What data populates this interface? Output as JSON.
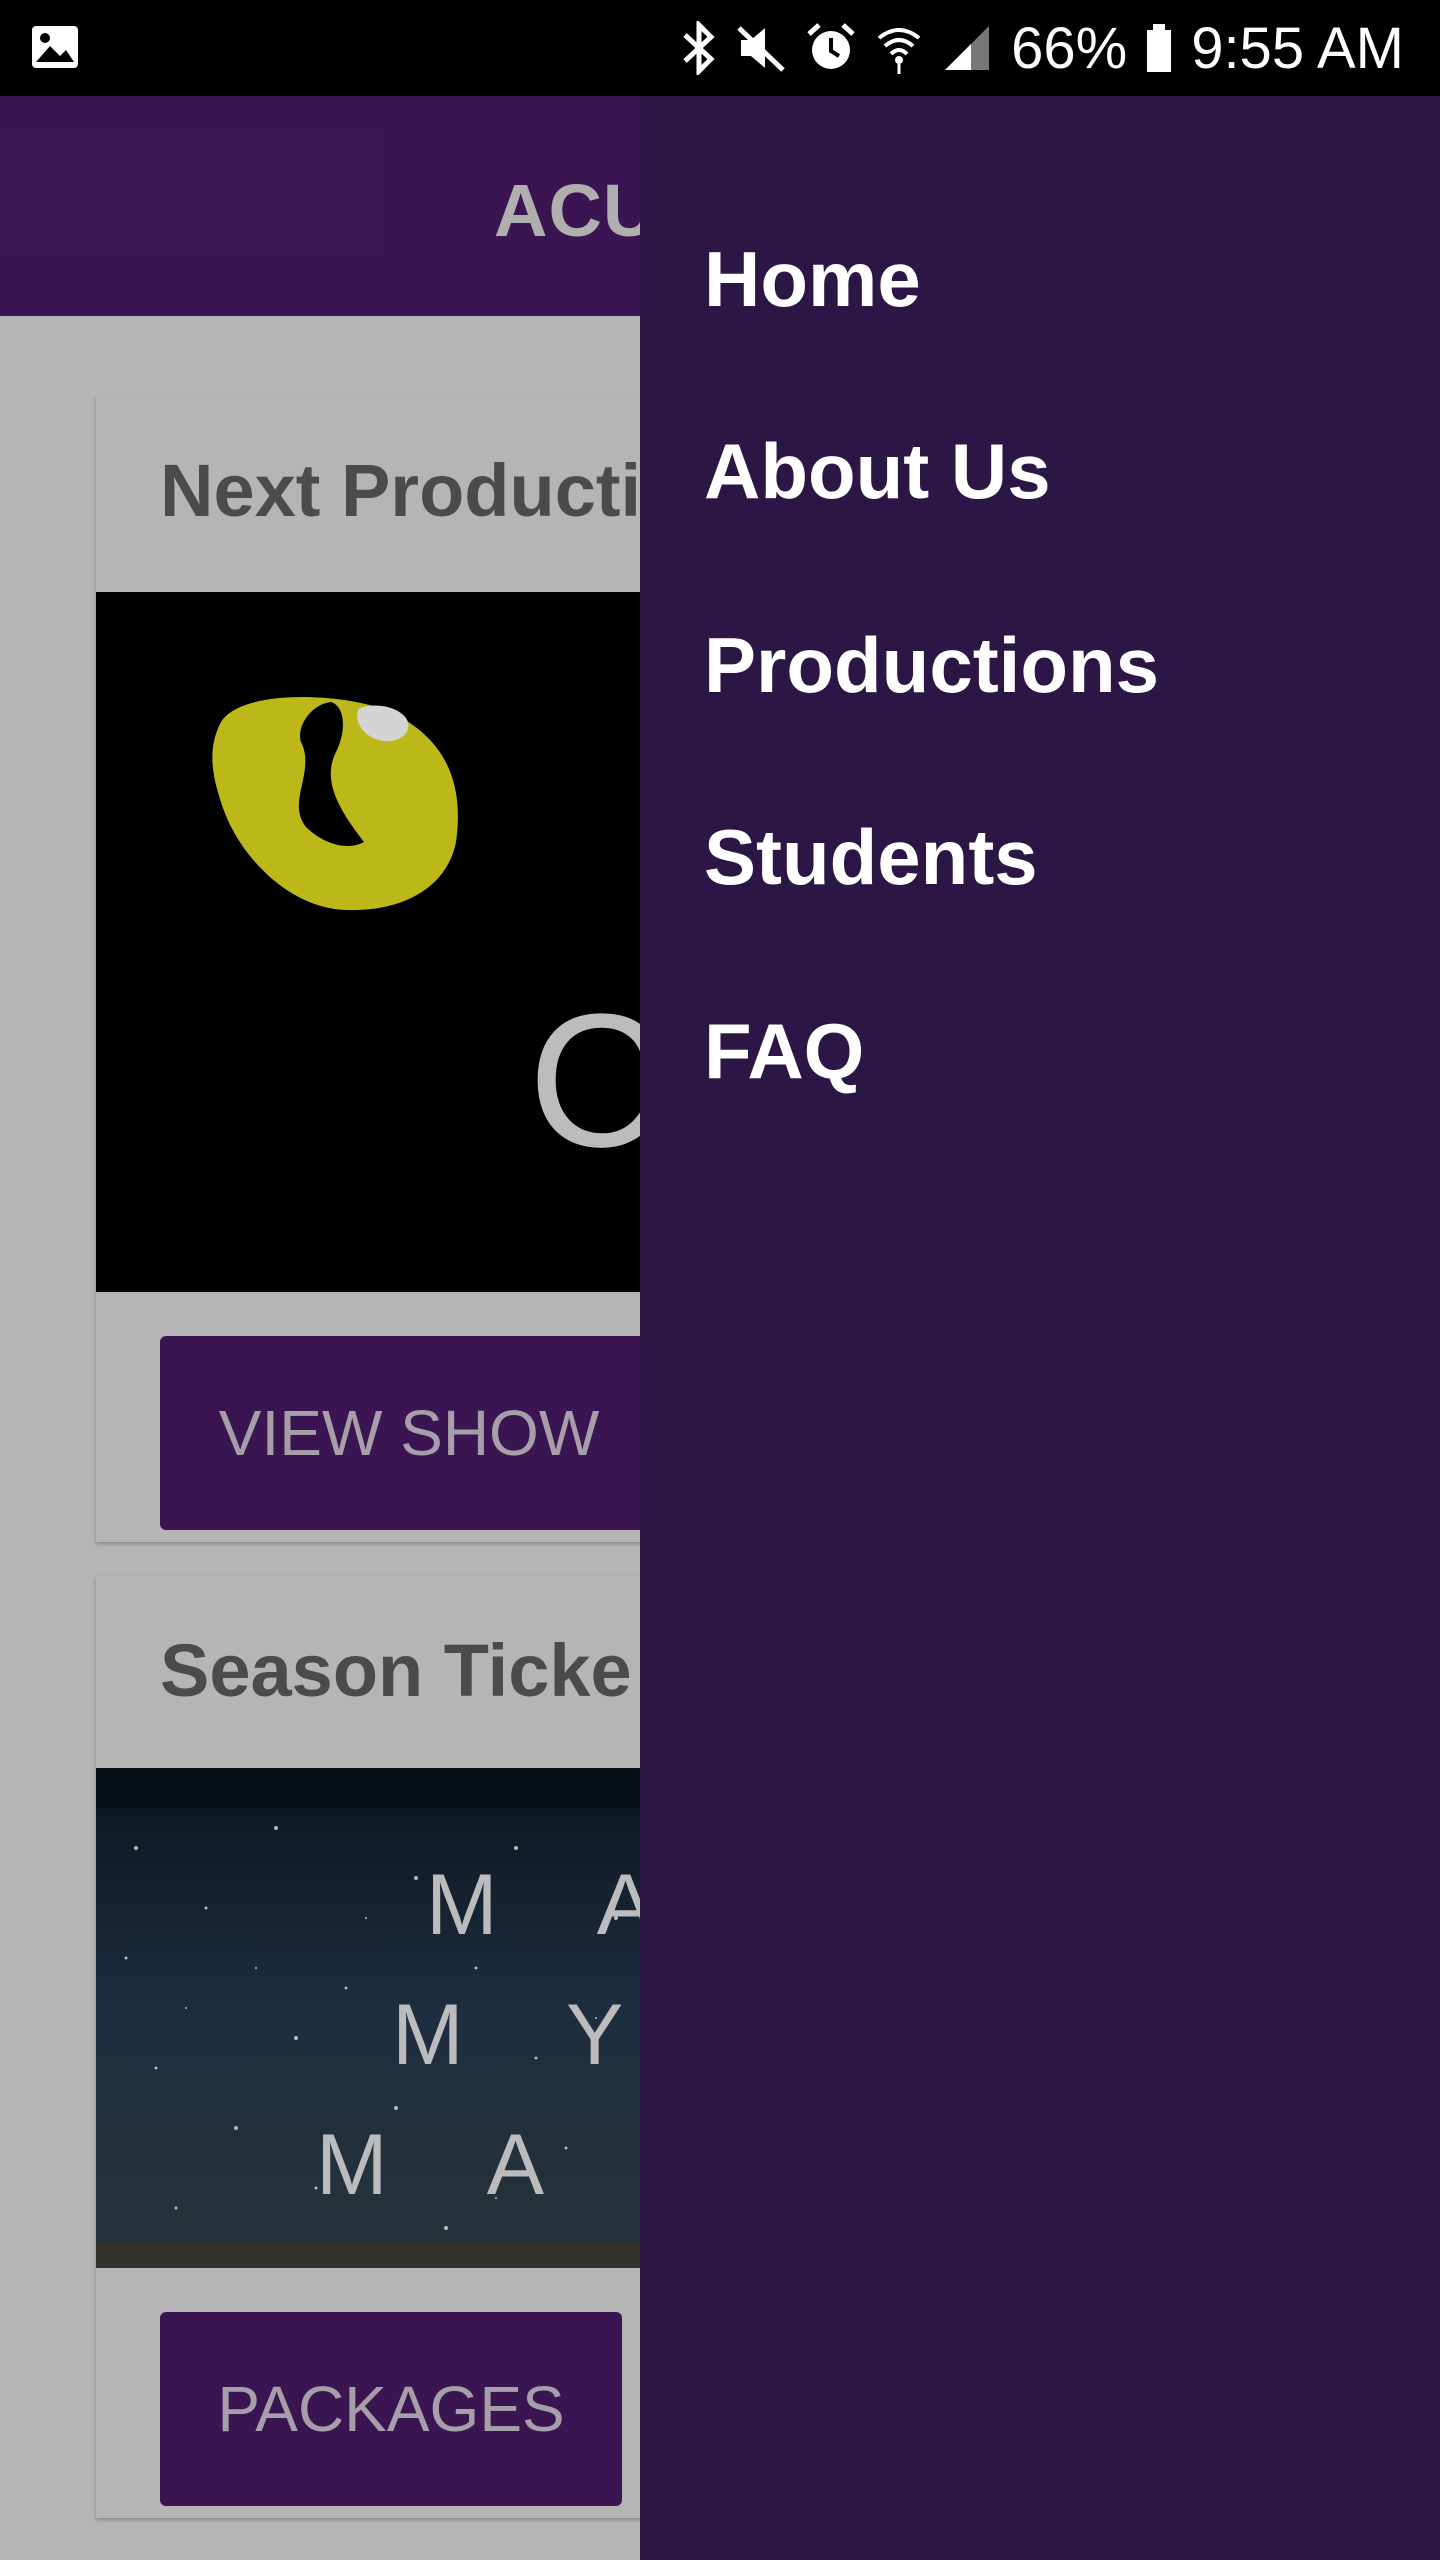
{
  "status_bar": {
    "battery": "66%",
    "time": "9:55 AM",
    "icons": [
      "image-icon",
      "bluetooth-icon",
      "mute-icon",
      "alarm-icon",
      "wifi-icon",
      "signal-icon",
      "battery-icon"
    ]
  },
  "app_bar": {
    "title": "ACU"
  },
  "cards": [
    {
      "title": "Next Producti",
      "image": "cats-poster",
      "poster_letter": "C",
      "button_label": "VIEW SHOW"
    },
    {
      "title": "Season Ticke",
      "image": "season-poster",
      "poster_lines": [
        "M A",
        "M Y S",
        "M A R V"
      ],
      "button_label": "PACKAGES"
    }
  ],
  "drawer": {
    "items": [
      {
        "label": "Home"
      },
      {
        "label": "About Us"
      },
      {
        "label": "Productions"
      },
      {
        "label": "Students"
      },
      {
        "label": "FAQ"
      }
    ]
  },
  "colors": {
    "app_bar": "#44185e",
    "drawer": "#2c1645",
    "button": "#44185e",
    "content_bg": "#cfcfcf"
  }
}
